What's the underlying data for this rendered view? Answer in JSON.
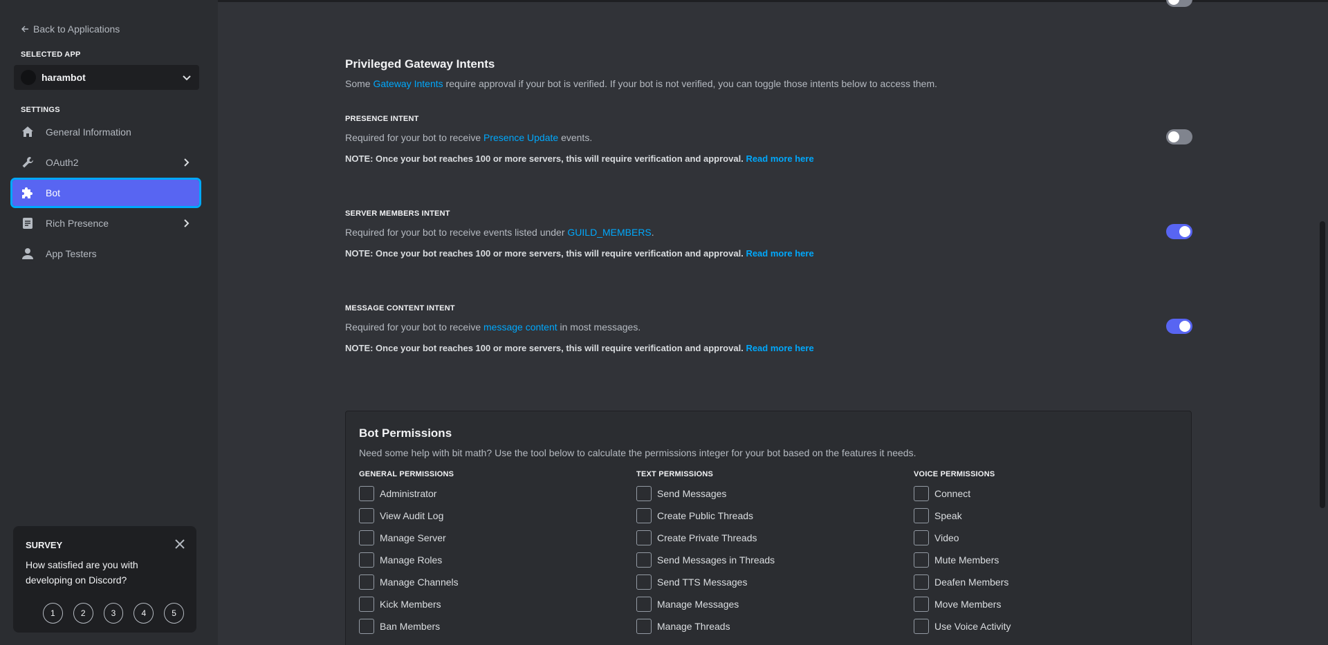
{
  "sidebar": {
    "back_label": "Back to Applications",
    "selected_app_label": "SELECTED APP",
    "app_name": "harambot",
    "settings_label": "SETTINGS",
    "items": [
      {
        "label": "General Information",
        "icon": "home-icon"
      },
      {
        "label": "OAuth2",
        "icon": "wrench-icon"
      },
      {
        "label": "Bot",
        "icon": "puzzle-icon"
      },
      {
        "label": "Rich Presence",
        "icon": "document-icon"
      },
      {
        "label": "App Testers",
        "icon": "user-icon"
      }
    ]
  },
  "survey": {
    "title": "SURVEY",
    "question": "How satisfied are you with developing on Discord?",
    "options": [
      "1",
      "2",
      "3",
      "4",
      "5"
    ]
  },
  "intents": {
    "title": "Privileged Gateway Intents",
    "desc_pre": "Some ",
    "desc_link": "Gateway Intents",
    "desc_post": " require approval if your bot is verified. If your bot is not verified, you can toggle those intents below to access them.",
    "note_text": "NOTE: Once your bot reaches 100 or more servers, this will require verification and approval.",
    "note_link": "Read more here",
    "presence": {
      "label": "PRESENCE INTENT",
      "desc_pre": "Required for your bot to receive ",
      "desc_link": "Presence Update",
      "desc_post": " events.",
      "enabled": false
    },
    "members": {
      "label": "SERVER MEMBERS INTENT",
      "desc_pre": "Required for your bot to receive events listed under ",
      "desc_link": "GUILD_MEMBERS",
      "desc_post": ".",
      "enabled": true
    },
    "message": {
      "label": "MESSAGE CONTENT INTENT",
      "desc_pre": "Required for your bot to receive ",
      "desc_link": "message content",
      "desc_post": " in most messages.",
      "enabled": true
    }
  },
  "permissions": {
    "title": "Bot Permissions",
    "desc": "Need some help with bit math? Use the tool below to calculate the permissions integer for your bot based on the features it needs.",
    "general_title": "GENERAL PERMISSIONS",
    "general": [
      "Administrator",
      "View Audit Log",
      "Manage Server",
      "Manage Roles",
      "Manage Channels",
      "Kick Members",
      "Ban Members"
    ],
    "text_title": "TEXT PERMISSIONS",
    "text": [
      "Send Messages",
      "Create Public Threads",
      "Create Private Threads",
      "Send Messages in Threads",
      "Send TTS Messages",
      "Manage Messages",
      "Manage Threads"
    ],
    "voice_title": "VOICE PERMISSIONS",
    "voice": [
      "Connect",
      "Speak",
      "Video",
      "Mute Members",
      "Deafen Members",
      "Move Members",
      "Use Voice Activity"
    ]
  }
}
